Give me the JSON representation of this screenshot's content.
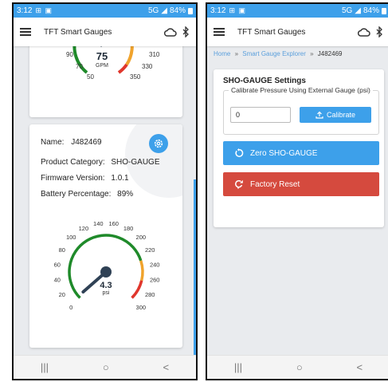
{
  "status_bar": {
    "time": "3:12",
    "status_icons": "⊞ ▣",
    "network": "5G",
    "battery": "84%"
  },
  "app": {
    "title": "TFT Smart Gauges"
  },
  "left_screen": {
    "top_gauge": {
      "value": "75",
      "unit": "GPM",
      "ticks": [
        "90",
        "310",
        "70",
        "330",
        "50",
        "350"
      ]
    },
    "device": {
      "name_label": "Name:",
      "name_value": "J482469",
      "category_label": "Product Category:",
      "category_value": "SHO-GAUGE",
      "firmware_label": "Firmware Version:",
      "firmware_value": "1.0.1",
      "battery_label": "Battery Percentage:",
      "battery_value": "89%"
    },
    "gauge": {
      "value": "4.3",
      "unit": "psi",
      "ticks": [
        "0",
        "20",
        "40",
        "60",
        "80",
        "100",
        "120",
        "140",
        "160",
        "180",
        "200",
        "220",
        "240",
        "260",
        "280",
        "300"
      ],
      "min": 0,
      "max": 300,
      "reading": 4.3
    }
  },
  "right_screen": {
    "breadcrumb": {
      "home": "Home",
      "sep1": "»",
      "explorer": "Smart Gauge Explorer",
      "sep2": "»",
      "current": "J482469"
    },
    "settings": {
      "title": "SHO-GAUGE Settings",
      "calibrate_legend": "Calibrate Pressure Using External Gauge (psi)",
      "calibrate_value": "0",
      "calibrate_button": "Calibrate",
      "zero_button": "Zero SHO-GAUGE",
      "reset_button": "Factory Reset"
    }
  },
  "nav": {
    "recents": "|||",
    "home": "○",
    "back": "<"
  },
  "colors": {
    "primary": "#3da0ea",
    "danger": "#d54a3e",
    "gauge_green": "#1f8a2a",
    "gauge_orange": "#f0a32c",
    "gauge_red": "#e0362c"
  }
}
